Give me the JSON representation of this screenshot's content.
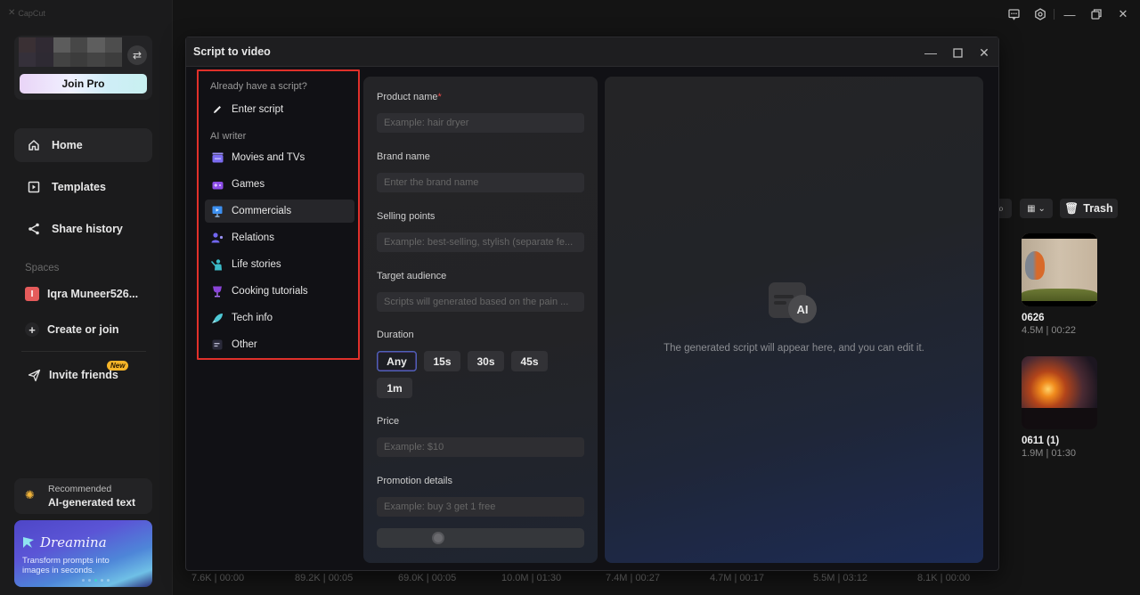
{
  "app": {
    "name": "CapCut",
    "window_controls": [
      "feedback",
      "settings",
      "minimize",
      "restore",
      "close"
    ]
  },
  "sidebar": {
    "profile": {
      "switch_icon": "swap-arrows-icon",
      "join_pro_label": "Join Pro"
    },
    "nav": [
      {
        "label": "Home",
        "icon": "home-icon",
        "active": true
      },
      {
        "label": "Templates",
        "icon": "templates-icon",
        "active": false
      },
      {
        "label": "Share history",
        "icon": "share-icon",
        "active": false
      }
    ],
    "spaces_label": "Spaces",
    "space": {
      "badge": "I",
      "name": "Iqra Muneer526...",
      "badge_color": "#e55b5b"
    },
    "create_label": "Create or join",
    "invite_label": "Invite friends",
    "new_badge": "New",
    "recommended": {
      "small": "Recommended",
      "title": "AI-generated text"
    },
    "promo": {
      "title": "Dreamina",
      "subtitle": "Transform prompts into images in seconds.",
      "dots": 5,
      "active_dot": 3
    }
  },
  "background": {
    "toolbar": {
      "trash_label": "Trash"
    },
    "media": [
      {
        "title": "0626",
        "meta": "4.5M | 00:22"
      },
      {
        "title": "0611 (1)",
        "meta": "1.9M | 01:30"
      }
    ],
    "bottom_meta": [
      "7.6K | 00:00",
      "89.2K | 00:05",
      "69.0K | 00:05",
      "10.0M | 01:30",
      "7.4M | 00:27",
      "4.7M | 00:17",
      "5.5M | 03:12",
      "8.1K | 00:00"
    ]
  },
  "dialog": {
    "title": "Script to video",
    "categories": {
      "already_label": "Already have a script?",
      "enter_script": "Enter script",
      "ai_writer_label": "AI writer",
      "items": [
        {
          "label": "Movies and TVs",
          "icon": "movie-clapper-icon",
          "color": "#7b6cf0"
        },
        {
          "label": "Games",
          "icon": "gamepad-icon",
          "color": "#8c4de8"
        },
        {
          "label": "Commercials",
          "icon": "billboard-icon",
          "color": "#3c8ff0",
          "active": true
        },
        {
          "label": "Relations",
          "icon": "people-icon",
          "color": "#7166f0"
        },
        {
          "label": "Life stories",
          "icon": "person-waving-icon",
          "color": "#3bbbc8"
        },
        {
          "label": "Cooking tutorials",
          "icon": "goblet-icon",
          "color": "#8a44d8"
        },
        {
          "label": "Tech info",
          "icon": "rocket-icon",
          "color": "#4fc9d6"
        },
        {
          "label": "Other",
          "icon": "note-icon",
          "color": "#8585a0"
        }
      ]
    },
    "form": {
      "product_name": {
        "label": "Product name",
        "required_mark": "*",
        "value": "",
        "placeholder": "Example: hair dryer"
      },
      "brand_name": {
        "label": "Brand name",
        "value": "",
        "placeholder": "Enter the brand name"
      },
      "selling_points": {
        "label": "Selling points",
        "value": "",
        "placeholder": "Example: best-selling, stylish (separate fe..."
      },
      "target_audience": {
        "label": "Target audience",
        "value": "",
        "placeholder": "Scripts will generated based on the pain ..."
      },
      "duration": {
        "label": "Duration",
        "options": [
          "Any",
          "15s",
          "30s",
          "45s",
          "1m"
        ],
        "selected": "Any"
      },
      "price": {
        "label": "Price",
        "value": "",
        "placeholder": "Example: $10"
      },
      "promotion": {
        "label": "Promotion details",
        "value": "",
        "placeholder": "Example: buy 3 get 1 free"
      },
      "generate_state": "loading"
    },
    "result": {
      "icon_text": "AI",
      "placeholder_text": "The generated script will appear here, and you can edit it."
    }
  }
}
